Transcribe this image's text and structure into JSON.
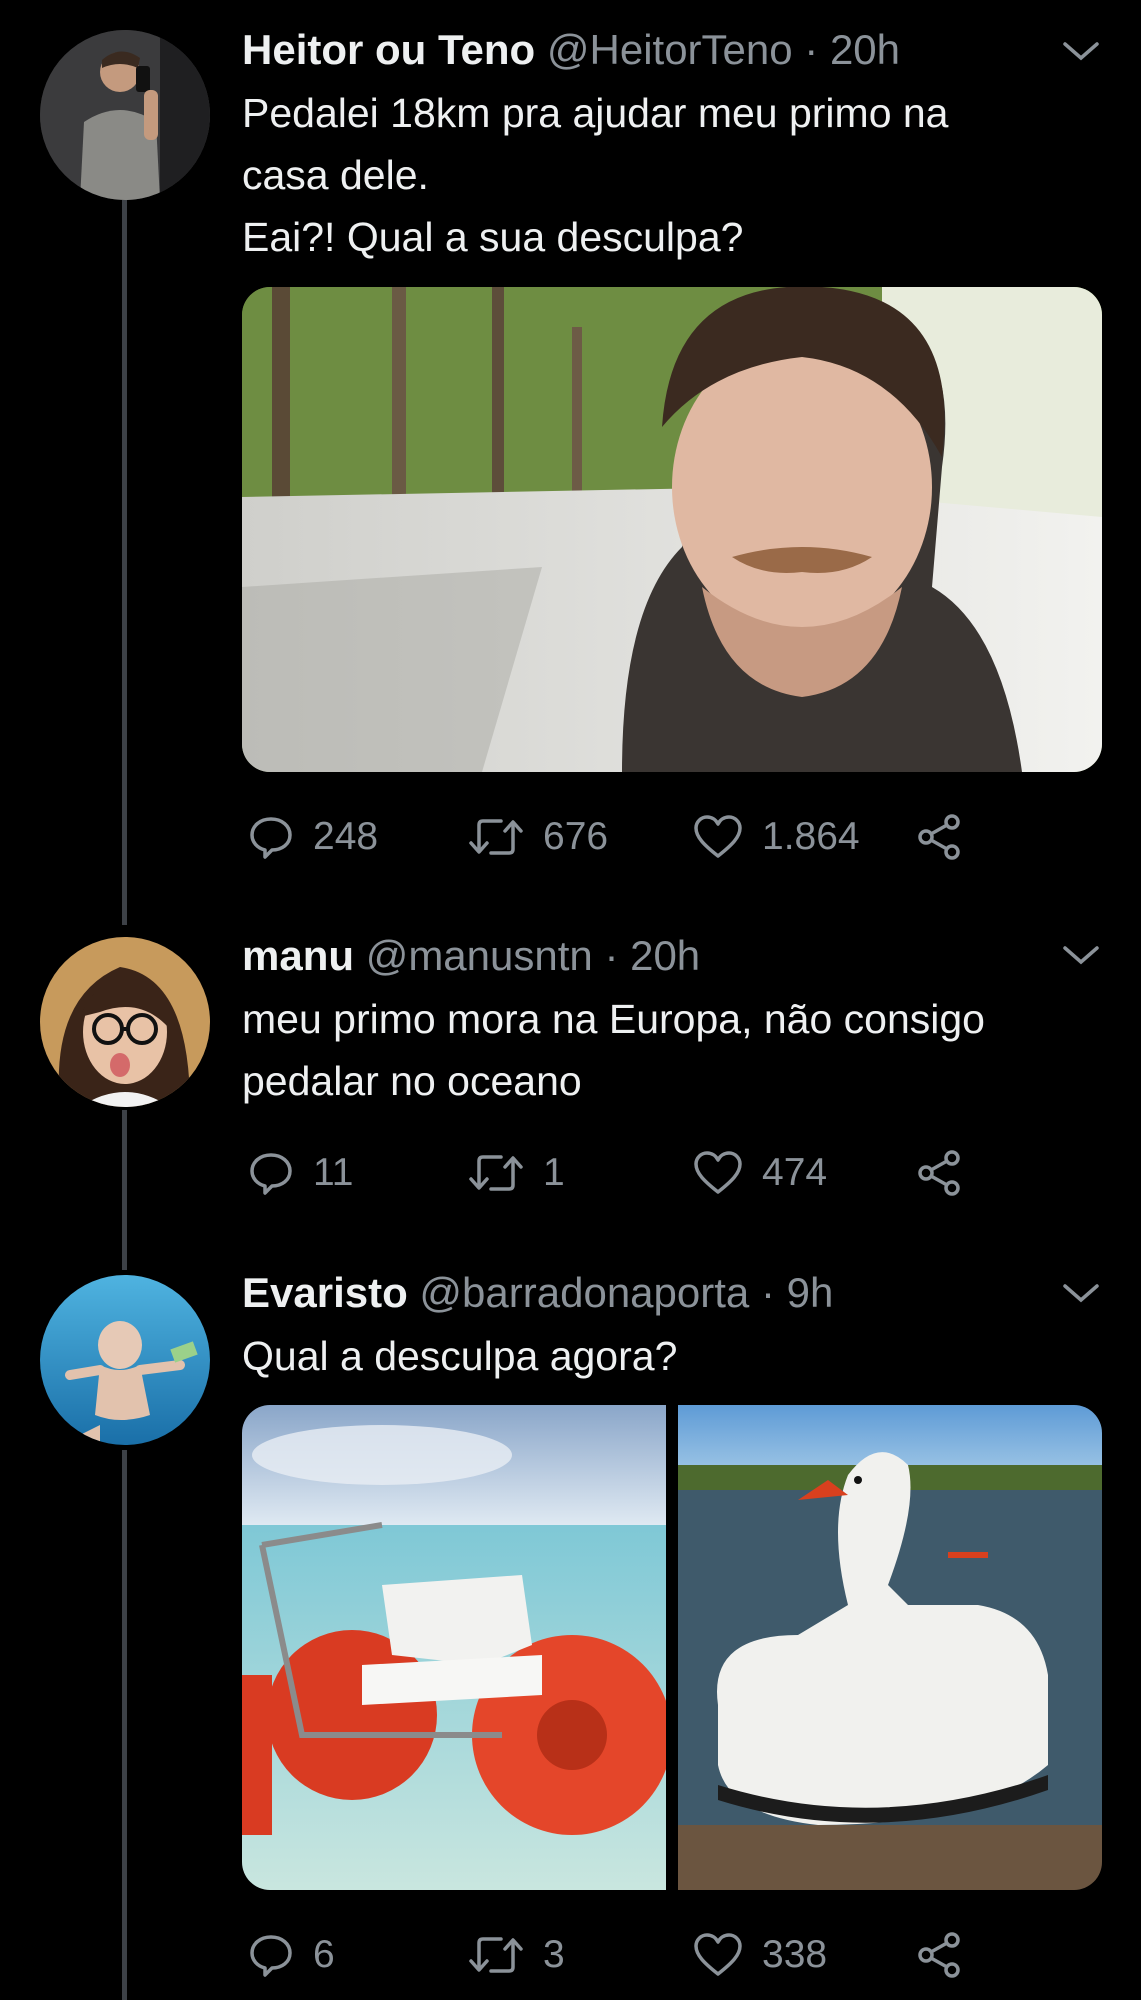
{
  "tweets": [
    {
      "name": "Heitor ou Teno",
      "meta": "@HeitorTeno · 20h",
      "lines": [
        "Pedalei 18km pra ajudar meu primo na",
        "casa dele.",
        "Eai?! Qual a sua desculpa?"
      ],
      "replies": "248",
      "retweets": "676",
      "likes": "1.864"
    },
    {
      "name": "manu",
      "meta": "@manusntn · 20h",
      "lines": [
        "meu primo mora na Europa, não consigo",
        "pedalar no oceano"
      ],
      "replies": "11",
      "retweets": "1",
      "likes": "474"
    },
    {
      "name": "Evaristo",
      "meta": "@barradonaporta · 9h",
      "lines": [
        "Qual a desculpa agora?"
      ],
      "replies": "6",
      "retweets": "3",
      "likes": "338"
    }
  ],
  "icons": {
    "reply": "reply-icon",
    "retweet": "retweet-icon",
    "like": "heart-icon",
    "share": "share-icon",
    "menu": "chevron-down-icon"
  },
  "colors": {
    "background": "#000000",
    "text": "#eef0f1",
    "muted": "#8b9299",
    "thread_line": "#3d4147"
  }
}
